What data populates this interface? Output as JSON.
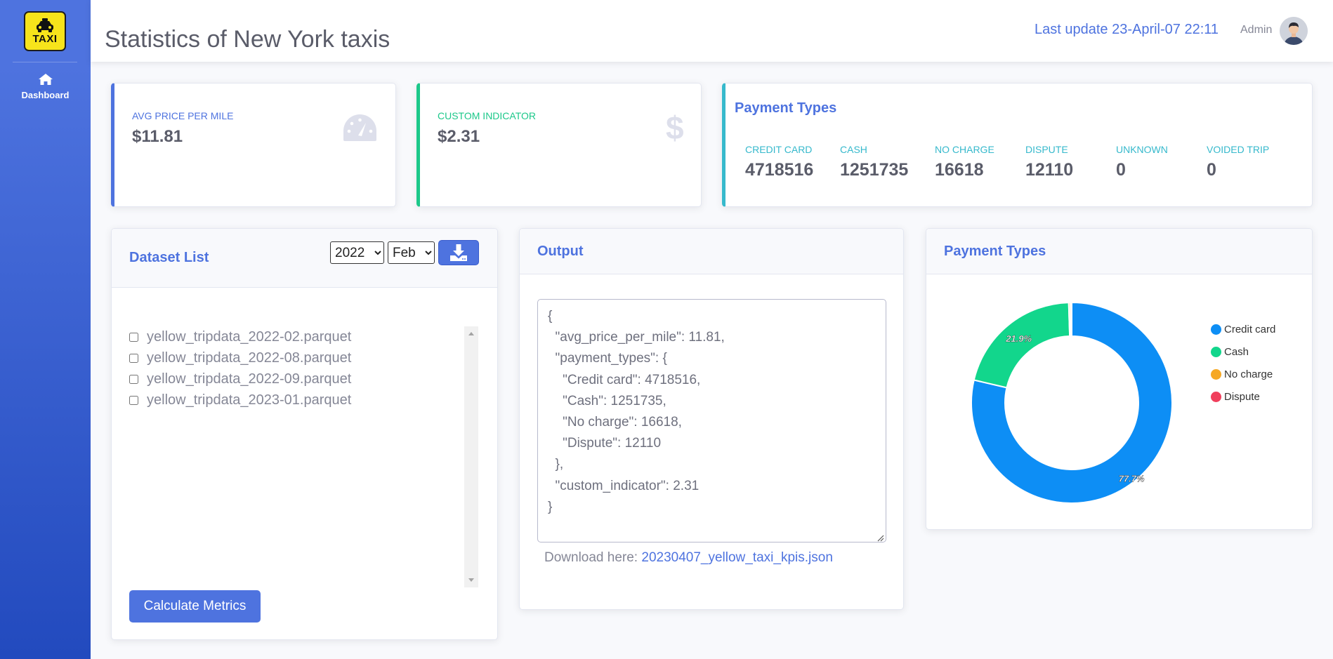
{
  "brand": {
    "text": "TAXI",
    "icon": "taxi-icon",
    "color": "#f7e41b"
  },
  "sidebar": {
    "items": [
      {
        "label": "Dashboard",
        "icon": "home-icon"
      }
    ]
  },
  "header": {
    "title": "Statistics of New York taxis",
    "last_update": "Last update 23-April-07 22:11",
    "user": "Admin"
  },
  "kpis": {
    "avg_price": {
      "label": "AVG PRICE PER MILE",
      "value": "$11.81",
      "icon": "tachometer-icon"
    },
    "custom": {
      "label": "CUSTOM INDICATOR",
      "value": "$2.31",
      "icon": "dollar-icon"
    }
  },
  "payment_summary": {
    "title": "Payment Types",
    "items": [
      {
        "label": "CREDIT CARD",
        "value": "4718516"
      },
      {
        "label": "CASH",
        "value": "1251735"
      },
      {
        "label": "NO CHARGE",
        "value": "16618"
      },
      {
        "label": "DISPUTE",
        "value": "12110"
      },
      {
        "label": "UNKNOWN",
        "value": "0"
      },
      {
        "label": "VOIDED TRIP",
        "value": "0"
      }
    ]
  },
  "dataset": {
    "title": "Dataset List",
    "year_selected": "2022",
    "month_selected": "Feb",
    "download_icon": "download-icon",
    "files": [
      "yellow_tripdata_2022-02.parquet",
      "yellow_tripdata_2022-08.parquet",
      "yellow_tripdata_2022-09.parquet",
      "yellow_tripdata_2023-01.parquet"
    ],
    "calc_button": "Calculate Metrics"
  },
  "output": {
    "title": "Output",
    "json_text": "{\n  \"avg_price_per_mile\": 11.81,\n  \"payment_types\": {\n    \"Credit card\": 4718516,\n    \"Cash\": 1251735,\n    \"No charge\": 16618,\n    \"Dispute\": 12110\n  },\n  \"custom_indicator\": 2.31\n}",
    "download_prefix": "Download here:",
    "download_link": "20230407_yellow_taxi_kpis.json"
  },
  "payment_chart": {
    "title": "Payment Types",
    "colors": {
      "Credit card": "#0d8ef5",
      "Cash": "#12d68c",
      "No charge": "#f6a823",
      "Dispute": "#f03f5c"
    }
  },
  "chart_data": {
    "type": "pie",
    "donut": true,
    "categories": [
      "Credit card",
      "Cash",
      "No charge",
      "Dispute"
    ],
    "values": [
      4718516,
      1251735,
      16618,
      12110
    ],
    "data_labels": [
      "77.7%",
      "21.9%"
    ],
    "legend": "right"
  }
}
